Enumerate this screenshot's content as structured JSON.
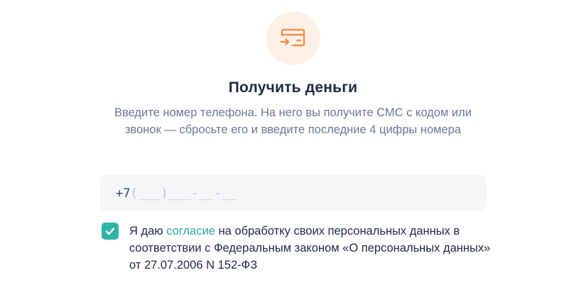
{
  "header": {
    "icon": "card-receive-icon",
    "title": "Получить деньги",
    "subtitle": "Введите номер телефона. На него вы получите СМС с кодом или звонок — сбросьте его и введите последние 4 цифры номера"
  },
  "phone": {
    "prefix": "+7",
    "mask": "(___)___-__-__"
  },
  "consent": {
    "checked": true,
    "text_before": "Я даю ",
    "link": "согласие",
    "text_after": " на обработку своих персональных данных в соответствии с Федеральным законом «О персональных данных» от 27.07.2006 N 152-ФЗ"
  },
  "colors": {
    "accent": "#2fb3a6",
    "icon_orange": "#f0914a",
    "icon_bg": "#fdf1e7",
    "title": "#1f2a44",
    "subtitle": "#6b7794"
  }
}
